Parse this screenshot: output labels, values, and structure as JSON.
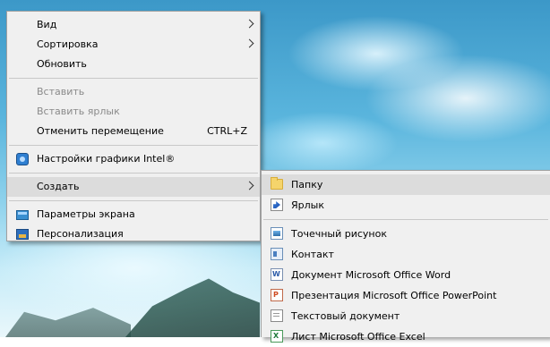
{
  "main_menu": {
    "view": "Вид",
    "sort": "Сортировка",
    "refresh": "Обновить",
    "paste": "Вставить",
    "paste_shortcut": "Вставить ярлык",
    "undo_move": "Отменить перемещение",
    "undo_move_shortcut": "CTRL+Z",
    "intel_graphics": "Настройки графики Intel®",
    "create": "Создать",
    "display_settings": "Параметры экрана",
    "personalization": "Персонализация"
  },
  "sub_menu": {
    "folder": "Папку",
    "shortcut": "Ярлык",
    "bitmap": "Точечный рисунок",
    "contact": "Контакт",
    "word_doc": "Документ Microsoft Office Word",
    "ppt": "Презентация Microsoft Office PowerPoint",
    "text_doc": "Текстовый документ",
    "excel": "Лист Microsoft Office Excel"
  },
  "icons": {
    "intel": "intel-graphics-icon",
    "display": "display-settings-icon",
    "personalization": "personalization-icon",
    "folder": "folder-icon",
    "shortcut": "shortcut-icon",
    "bitmap": "bitmap-image-icon",
    "contact": "contact-icon",
    "word": "word-document-icon",
    "ppt": "powerpoint-icon",
    "text": "text-document-icon",
    "excel": "excel-icon"
  }
}
